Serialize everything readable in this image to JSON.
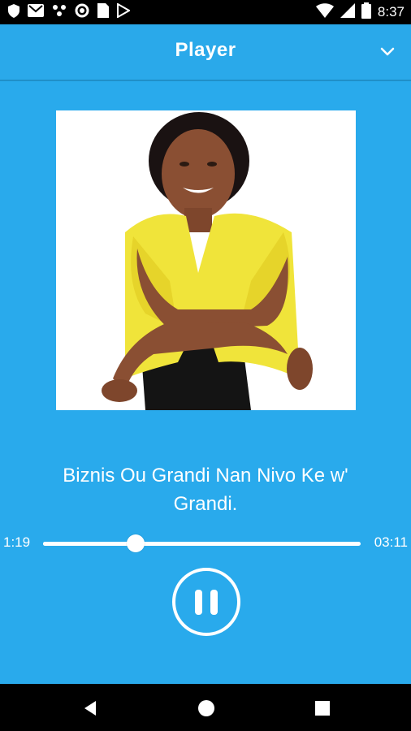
{
  "status_bar": {
    "time": "8:37",
    "left_icons": [
      "shield-icon",
      "gmail-icon",
      "dots-icon",
      "circle-icon",
      "sim-icon",
      "play-store-icon"
    ],
    "right_icons": [
      "wifi-icon",
      "signal-icon",
      "battery-icon"
    ]
  },
  "app_bar": {
    "title": "Player",
    "collapse_icon": "chevron-down-icon"
  },
  "player": {
    "track_title": "Biznis Ou Grandi Nan Nivo Ke w' Grandi.",
    "current_time": "1:19",
    "total_time": "03:11",
    "progress_fraction": 0.291,
    "state_icon": "pause-icon"
  },
  "nav_bar": {
    "buttons": [
      "back-icon",
      "home-icon",
      "recents-icon"
    ]
  },
  "colors": {
    "background": "#29aaec",
    "foreground": "#ffffff"
  }
}
